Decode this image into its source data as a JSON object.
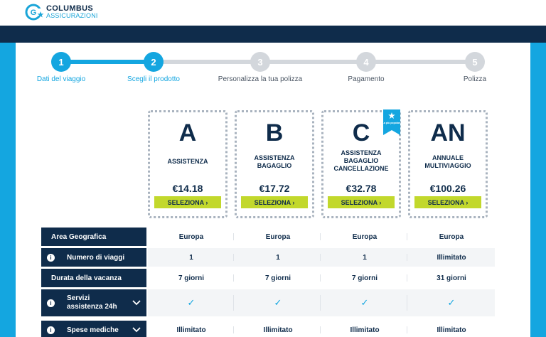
{
  "brand": {
    "name_line1": "COLUMBUS",
    "name_line2": "ASSICURAZIONI"
  },
  "colors": {
    "navy": "#0f2c4b",
    "accent": "#14a6e0",
    "green": "#c2d82c",
    "gray_step": "#d3d7dc"
  },
  "steps": [
    {
      "num": "1",
      "label": "Dati del viaggio",
      "state": "done"
    },
    {
      "num": "2",
      "label": "Scegli il prodotto",
      "state": "active"
    },
    {
      "num": "3",
      "label": "Personalizza la tua polizza",
      "state": "todo"
    },
    {
      "num": "4",
      "label": "Pagamento",
      "state": "todo"
    },
    {
      "num": "5",
      "label": "Polizza",
      "state": "todo"
    }
  ],
  "plans": [
    {
      "letter": "A",
      "name": "ASSISTENZA",
      "price": "€14.18",
      "button": "SELEZIONA ›"
    },
    {
      "letter": "B",
      "name": "ASSISTENZA BAGAGLIO",
      "price": "€17.72",
      "button": "SELEZIONA ›"
    },
    {
      "letter": "C",
      "name": "ASSISTENZA BAGAGLIO CANCELLAZIONE",
      "price": "€32.78",
      "button": "SELEZIONA ›",
      "badge": "La più popolare"
    },
    {
      "letter": "AN",
      "name": "ANNUALE MULTIVIAGGIO",
      "price": "€100.26",
      "button": "SELEZIONA ›"
    }
  ],
  "table": [
    {
      "label": "Area Geografica",
      "info": false,
      "expand": false,
      "values": [
        "Europa",
        "Europa",
        "Europa",
        "Europa"
      ]
    },
    {
      "label": "Numero di viaggi",
      "info": true,
      "expand": false,
      "values": [
        "1",
        "1",
        "1",
        "Illimitato"
      ]
    },
    {
      "label": "Durata della vacanza",
      "info": false,
      "expand": false,
      "values": [
        "7 giorni",
        "7 giorni",
        "7 giorni",
        "31 giorni"
      ]
    },
    {
      "label": "Servizi assistenza 24h",
      "info": true,
      "expand": true,
      "values": [
        "✓",
        "✓",
        "✓",
        "✓"
      ]
    },
    {
      "label": "Spese mediche",
      "info": true,
      "expand": true,
      "values": [
        "Illimitato",
        "Illimitato",
        "Illimitato",
        "Illimitato"
      ]
    }
  ]
}
